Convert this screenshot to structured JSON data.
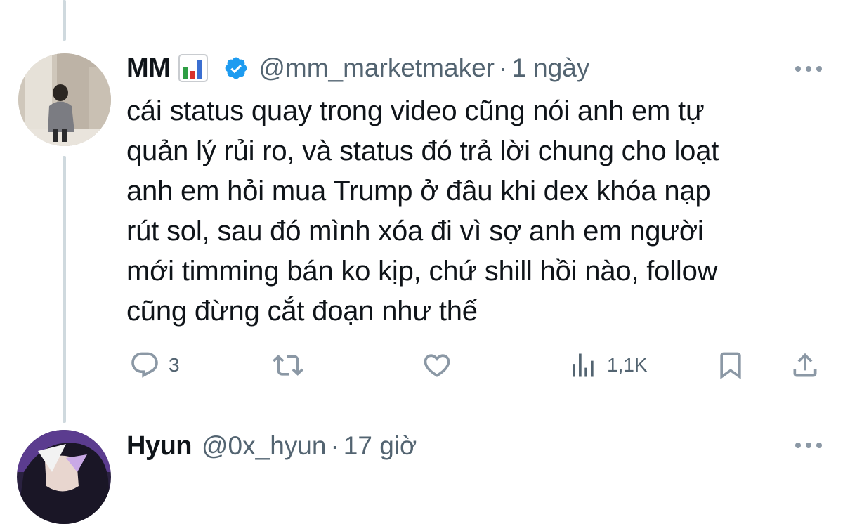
{
  "tweet": {
    "author_name": "MM",
    "author_emoji": "bar-chart-emoji",
    "handle": "@mm_marketmaker",
    "separator": "·",
    "time": "1 ngày",
    "text_lines": [
      "cái status quay trong video cũng nói anh em tự",
      "quản lý rủi ro, và status đó trả lời chung cho loạt",
      "anh em hỏi mua Trump ở đâu khi dex khóa nạp",
      "rút sol, sau đó mình xóa đi vì sợ anh em người",
      "mới timming bán ko kịp, chứ shill hồi nào, follow",
      "cũng đừng cắt đoạn như thế"
    ],
    "actions": {
      "reply_count": "3",
      "views_count": "1,1K"
    }
  },
  "next_tweet": {
    "author_name": "Hyun",
    "handle": "@0x_hyun",
    "separator": "·",
    "time": "17 giờ"
  },
  "colors": {
    "verified": "#1d9bf0",
    "secondary_text": "#536471",
    "thread_line": "#cfd9de"
  }
}
